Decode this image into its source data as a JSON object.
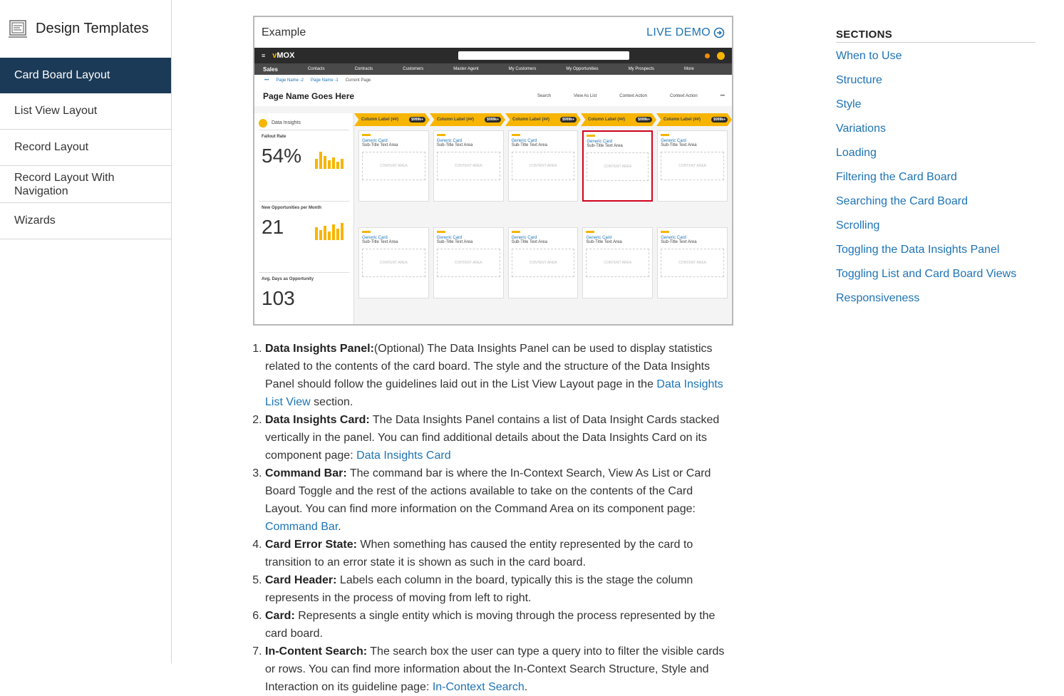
{
  "sidebar": {
    "title": "Design Templates",
    "items": [
      {
        "label": "Card Board Layout"
      },
      {
        "label": "List View Layout"
      },
      {
        "label": "Record Layout"
      },
      {
        "label": "Record Layout With Navigation"
      },
      {
        "label": "Wizards"
      }
    ]
  },
  "example": {
    "label": "Example",
    "live_demo": "LIVE DEMO",
    "shot": {
      "page_name": "Page Name Goes Here",
      "breadcrumbs": [
        "Page Name -2",
        "Page Name -1",
        "Current Page"
      ],
      "tabs": [
        "Sales",
        "Contacts",
        "Contracts",
        "Customers",
        "Master Agent",
        "My Customers",
        "My Opportunities",
        "My Prospects",
        "More"
      ],
      "commands": [
        "Search",
        "View As List",
        "Context Action",
        "Context Action"
      ],
      "insights_title": "Data Insights",
      "insights": [
        {
          "label": "Fallout Rate",
          "value": "54%"
        },
        {
          "label": "New Opportunities per Month",
          "value": "21"
        },
        {
          "label": "Avg. Days as Opportunity",
          "value": "103"
        }
      ],
      "column_label": "Column Label (##)",
      "column_pill": "$999k+",
      "card_title": "Generic Card",
      "card_subtitle": "Sub-Title Text Area",
      "card_content": "CONTENT AREA"
    }
  },
  "list": [
    {
      "bold": "Data Insights Panel:",
      "text": "(Optional) The Data Insights Panel can be used to display statistics related to the contents of the card board. The style and the structure of the Data Insights Panel should follow the guidelines laid out in the List View Layout page in the ",
      "link": "Data Insights List View",
      "after": " section."
    },
    {
      "bold": "Data Insights Card:",
      "text": " The Data Insights Panel contains a list of Data Insight Cards stacked vertically in the panel. You can find additional details about the Data Insights Card on its component page: ",
      "link": "Data Insights Card",
      "after": ""
    },
    {
      "bold": "Command Bar:",
      "text": " The command bar is where the In-Context Search, View As List or Card Board Toggle and the rest of the actions available to take on the contents of the Card Layout. You can find more information on the Command Area on its component page: ",
      "link": "Command Bar",
      "after": "."
    },
    {
      "bold": "Card Error State:",
      "text": " When something has caused the entity represented by the card to transition to an error state it is shown as such in the card board.",
      "link": "",
      "after": ""
    },
    {
      "bold": "Card Header:",
      "text": " Labels each column in the board, typically this is the stage the column represents in the process of moving from left to right.",
      "link": "",
      "after": ""
    },
    {
      "bold": "Card:",
      "text": " Represents a single entity which is moving through the process represented by the card board.",
      "link": "",
      "after": ""
    },
    {
      "bold": "In-Content Search:",
      "text": " The search box the user can type a query into to filter the visible cards or rows. You can find more information about the In-Context Search Structure, Style and Interaction on its guideline page: ",
      "link": "In-Context Search",
      "after": "."
    }
  ],
  "sections": {
    "title": "SECTIONS",
    "links": [
      "When to Use",
      "Structure",
      "Style",
      "Variations",
      "Loading",
      "Filtering the Card Board",
      "Searching the Card Board",
      "Scrolling",
      "Toggling the Data Insights Panel",
      "Toggling List and Card Board Views",
      "Responsiveness"
    ]
  }
}
